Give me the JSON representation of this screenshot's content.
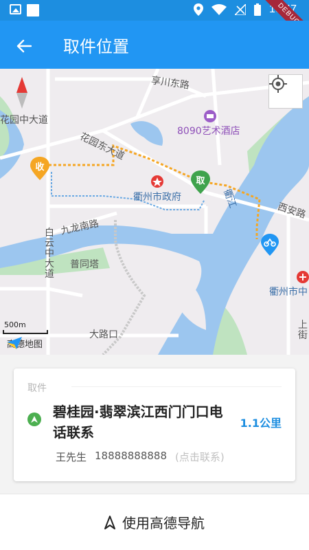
{
  "status_bar": {
    "time": "10:47",
    "debug_label": "DEBUG"
  },
  "app_bar": {
    "title": "取件位置"
  },
  "map": {
    "labels": [
      "享川东路",
      "花园中大道",
      "8090艺术酒店",
      "花园东大道",
      "衢州市政府",
      "衢江",
      "西安路",
      "九龙南路",
      "白云中大道",
      "普同塔",
      "衢州市中",
      "大路口",
      "上街"
    ],
    "pickup_marker": "取",
    "receive_marker": "收",
    "scale_text": "500m",
    "logo_text": "高德地图"
  },
  "card": {
    "tag": "取件",
    "address": "碧桂园·翡翠滨江西门门口电话联系",
    "distance": "1.1公里",
    "contact_name": "王先生",
    "contact_phone": "18888888888",
    "contact_hint": "(点击联系)"
  },
  "navigation": {
    "label": "使用高德导航"
  },
  "colors": {
    "primary": "#2196f3",
    "status_bar": "#1d8ee0",
    "accent_green": "#4caf50",
    "route": "#f5a623"
  }
}
